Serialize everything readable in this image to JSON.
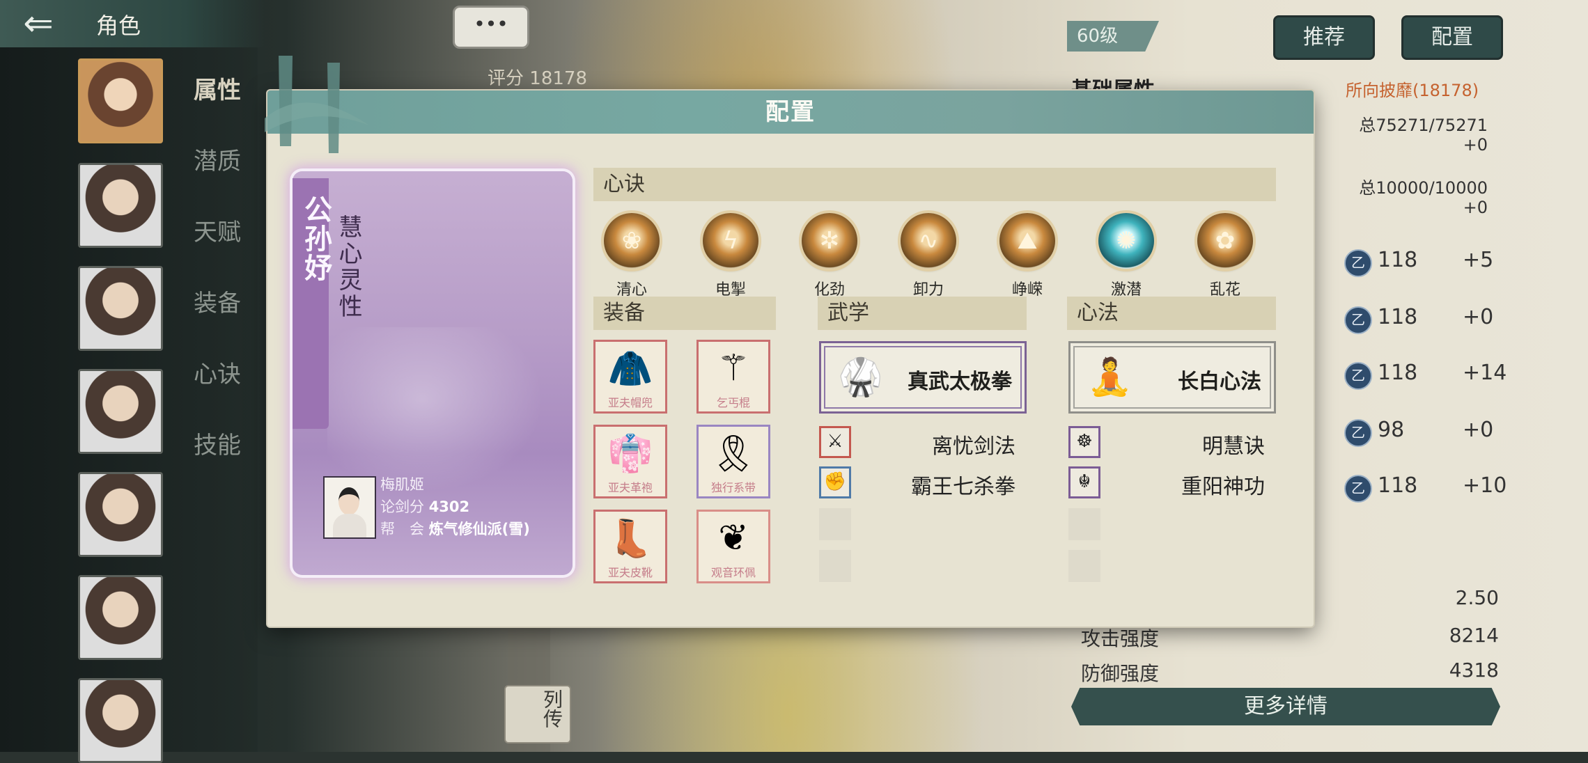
{
  "app": {
    "title": "角色",
    "back_label": "⇐"
  },
  "sidebar": {
    "tabs": [
      {
        "label": "属性",
        "active": true
      },
      {
        "label": "潜质"
      },
      {
        "label": "天赋"
      },
      {
        "label": "装备"
      },
      {
        "label": "心诀"
      },
      {
        "label": "技能"
      }
    ]
  },
  "top": {
    "chat_label": "•••",
    "score_label": "评分",
    "score_value": "18178",
    "level": "60级",
    "recommend_label": "推荐",
    "config_label": "配置"
  },
  "stats": {
    "base_title": "基础属性",
    "reputation": "所向披靡(18178)",
    "hp": "总75271/75271",
    "hp_bonus": "+0",
    "mp": "总10000/10000",
    "mp_bonus": "+0",
    "skill_rows": [
      {
        "value": "118",
        "bonus": "+5"
      },
      {
        "value": "118",
        "bonus": "+0"
      },
      {
        "value": "118",
        "bonus": "+14"
      },
      {
        "value": "98",
        "bonus": "+0"
      },
      {
        "value": "118",
        "bonus": "+10"
      }
    ],
    "attrs": [
      {
        "label": "",
        "value": "2.50"
      },
      {
        "label": "攻击强度",
        "value": "8214"
      },
      {
        "label": "防御强度",
        "value": "4318"
      }
    ],
    "more_details": "更多详情",
    "lie_zhuan": "列传"
  },
  "modal": {
    "title": "配置",
    "character": {
      "name": "公孙妤",
      "title": "慧心灵性",
      "user_name": "梅肌姬",
      "duel_label": "论剑分",
      "duel_value": "4302",
      "guild_label": "帮　会",
      "guild_value": "炼气修仙派(雪)"
    },
    "formula_header": "心诀",
    "formulas": [
      {
        "name": "清心",
        "icon": "lotus-icon"
      },
      {
        "name": "电掣",
        "icon": "lightning-icon"
      },
      {
        "name": "化劲",
        "icon": "swirl-icon"
      },
      {
        "name": "卸力",
        "icon": "wave-icon"
      },
      {
        "name": "峥嵘",
        "icon": "mountain-icon"
      },
      {
        "name": "激潜",
        "icon": "vortex-icon"
      },
      {
        "name": "乱花",
        "icon": "flower-icon"
      }
    ],
    "equipment_header": "装备",
    "equipment": [
      {
        "name": "亚夫帽兜",
        "icon": "hood-icon"
      },
      {
        "name": "乞丐棍",
        "icon": "staff-icon"
      },
      {
        "name": "亚夫革袍",
        "icon": "robe-icon"
      },
      {
        "name": "独行系带",
        "icon": "belt-icon"
      },
      {
        "name": "亚夫皮靴",
        "icon": "boots-icon"
      },
      {
        "name": "观音环佩",
        "icon": "pendant-icon"
      }
    ],
    "martial_header": "武学",
    "martial_main": "真武太极拳",
    "martial_slots": [
      "离忧剑法",
      "霸王七杀拳"
    ],
    "method_header": "心法",
    "method_main": "长白心法",
    "method_slots": [
      "明慧诀",
      "重阳神功"
    ]
  },
  "colors": {
    "modal_header": "#77a8a2",
    "card_purple": "#b79dc8",
    "section_header": "#d8d1b4",
    "reputation": "#c5622f"
  }
}
